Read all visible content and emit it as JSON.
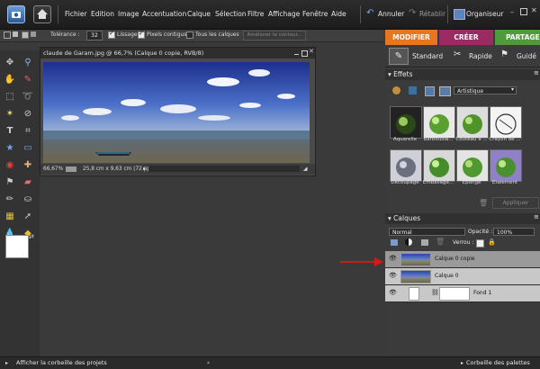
{
  "menu": {
    "items": [
      "Fichier",
      "Edition",
      "Image",
      "Accentuation",
      "Calque",
      "Sélection",
      "Filtre",
      "Affichage",
      "Fenêtre",
      "Aide"
    ],
    "undo": "Annuler",
    "redo": "Rétablir",
    "organizer": "Organiseur"
  },
  "options": {
    "tolerance_label": "Tolérance :",
    "tolerance_value": "32",
    "smoothing": "Lissage",
    "contiguous": "Pixels contigus",
    "all_layers": "Tous les calques",
    "refine": "Améliorer le contour..."
  },
  "tabs": {
    "modify": "MODIFIER",
    "create": "CRÉER",
    "share": "PARTAGER"
  },
  "modes": {
    "standard": "Standard",
    "quick": "Rapide",
    "guided": "Guidé"
  },
  "document": {
    "title": "claude de Garam.jpg @ 66,7% (Calque 0 copie, RVB/8)",
    "zoom": "66,67%",
    "size": "25,8 cm x 9,63 cm (72 ppp)"
  },
  "effects": {
    "header": "Effets",
    "category": "Artistique",
    "items": [
      "Aquarelle",
      "Barbouilla...",
      "Couteau à ...",
      "Crayon de ...",
      "Découpage",
      "Emballage...",
      "Éponge",
      "Étalement"
    ],
    "apply": "Appliquer"
  },
  "layers": {
    "header": "Calques",
    "blend": "Normal",
    "opacity_label": "Opacité :",
    "opacity_value": "100%",
    "lock_label": "Verrou :",
    "items": [
      "Calque 0 copie",
      "Calque 0",
      "Fond 1"
    ]
  },
  "bottom": {
    "projects": "Afficher la corbeille des projets",
    "palettes": "Corbeille des palettes"
  },
  "colors": {
    "modify_tab": "#e8761e",
    "create_tab": "#9b2a63",
    "share_tab": "#4f9a3a",
    "arrow": "#d81818",
    "selected_layer": "#9a9a9a"
  }
}
